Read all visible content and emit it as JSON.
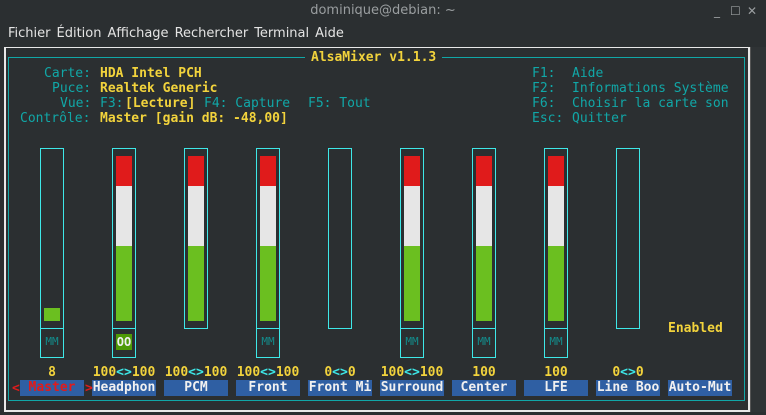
{
  "window": {
    "title": "dominique@debian: ~",
    "minimize": "_",
    "maximize": "☐",
    "close": "✕"
  },
  "menu": [
    "Fichier",
    "Édition",
    "Affichage",
    "Rechercher",
    "Terminal",
    "Aide"
  ],
  "mixer": {
    "title": "AlsaMixer v1.1.3",
    "info": [
      {
        "label": "Carte:",
        "value": "HDA Intel PCH"
      },
      {
        "label": "Puce:",
        "value": "Realtek Generic"
      },
      {
        "label": "Vue:",
        "f3": "F3:",
        "selected": "[Lecture]",
        "f4": "F4: Capture",
        "f5": "F5: Tout"
      },
      {
        "label": "Contrôle:",
        "value": "Master [gain dB: -48,00]"
      }
    ],
    "keys": [
      {
        "key": "F1:",
        "action": "Aide"
      },
      {
        "key": "F2:",
        "action": "Informations Système"
      },
      {
        "key": "F6:",
        "action": "Choisir la carte son"
      },
      {
        "key": "Esc:",
        "action": "Quitter"
      }
    ],
    "enabled": "Enabled",
    "selected_arrows": {
      "left": "<",
      "right": ">"
    },
    "channels": [
      {
        "name": "Master",
        "value": "8",
        "level": 8,
        "mute": "MM",
        "selected": true
      },
      {
        "name": "Headphon",
        "value": "100<>100",
        "level": 100,
        "mute": "OO"
      },
      {
        "name": "PCM",
        "value": "100<>100",
        "level": 100
      },
      {
        "name": "Front",
        "value": "100<>100",
        "level": 100,
        "mute": "MM"
      },
      {
        "name": "Front Mi",
        "value": "0<>0",
        "level": 0
      },
      {
        "name": "Surround",
        "value": "100<>100",
        "level": 100,
        "mute": "MM"
      },
      {
        "name": "Center",
        "value": "100",
        "level": 100,
        "mute": "MM"
      },
      {
        "name": "LFE",
        "value": "100",
        "level": 100,
        "mute": "MM"
      },
      {
        "name": "Line Boo",
        "value": "0<>0",
        "level": 0
      },
      {
        "name": "Auto-Mut",
        "value": ""
      }
    ]
  },
  "colors": {
    "red": "#e01b1b",
    "white": "#e6e6e6",
    "green": "#6bbf20",
    "cyan": "#11a7a7",
    "yellow": "#f2d33c",
    "label_bg": "#2f5fa3"
  }
}
